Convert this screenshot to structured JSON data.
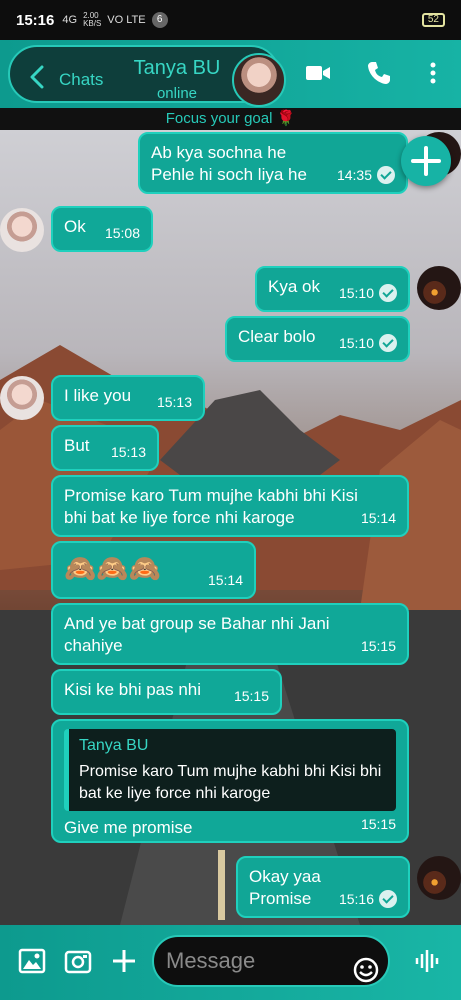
{
  "status_bar": {
    "time": "15:16",
    "signal": "4G",
    "net_speed_value": "2.00",
    "net_speed_unit": "KB/S",
    "network": "VO LTE",
    "notif_count": "6",
    "battery": "52"
  },
  "header": {
    "back_label": "Chats",
    "contact_name": "Tanya BU",
    "contact_status": "online"
  },
  "focus_banner": "Focus your goal 🌹",
  "messages": [
    {
      "text": "Ab kya sochna he\nPehle hi soch liya he",
      "time": "14:35",
      "dir": "out"
    },
    {
      "text": "Ok",
      "time": "15:08",
      "dir": "in"
    },
    {
      "text": "Kya ok",
      "time": "15:10",
      "dir": "out"
    },
    {
      "text": "Clear bolo",
      "time": "15:10",
      "dir": "out"
    },
    {
      "text": "I like you",
      "time": "15:13",
      "dir": "in"
    },
    {
      "text": "But",
      "time": "15:13",
      "dir": "in"
    },
    {
      "text": "Promise karo Tum mujhe kabhi bhi Kisi bhi bat ke liye force nhi karoge",
      "time": "15:14",
      "dir": "in"
    },
    {
      "text": "🙈🙈🙈",
      "time": "15:14",
      "dir": "in"
    },
    {
      "text": "And ye bat group se Bahar nhi Jani chahiye",
      "time": "15:15",
      "dir": "in"
    },
    {
      "text": "Kisi ke bhi pas nhi",
      "time": "15:15",
      "dir": "in"
    },
    {
      "text": "Give me promise",
      "time": "15:15",
      "dir": "in",
      "quote_name": "Tanya BU",
      "quote_text": "Promise karo Tum mujhe kabhi bhi Kisi bhi bat ke liye force nhi karoge"
    },
    {
      "text": "Okay yaa\nPromise",
      "time": "15:16",
      "dir": "out"
    }
  ],
  "input": {
    "placeholder": "Message"
  },
  "icons": {
    "back": "chevron-left-icon",
    "video": "video-camera-icon",
    "call": "phone-icon",
    "menu": "more-vertical-icon",
    "fab": "plus-icon",
    "gallery": "image-icon",
    "camera": "camera-icon",
    "attach": "plus-icon",
    "emoji": "emoji-icon",
    "voice": "voice-wave-icon"
  },
  "colors": {
    "accent": "#17b3a5",
    "accent_light": "#37d6c4",
    "bubble": "#10a898",
    "dark": "#0e3e3b"
  }
}
